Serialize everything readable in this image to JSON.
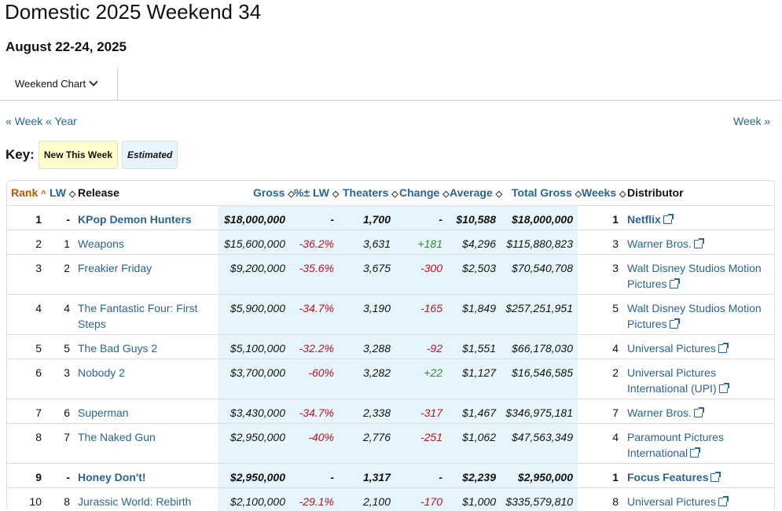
{
  "page": {
    "title": "Domestic 2025 Weekend 34",
    "subtitle": "August 22-24, 2025",
    "tab_label": "Weekend Chart",
    "nav_prev_week": "« Week",
    "nav_prev_year": "« Year",
    "nav_next_week": "Week »",
    "key_label": "Key:",
    "key_new": "New This Week",
    "key_estimated": "Estimated"
  },
  "columns": {
    "rank": "Rank",
    "lw": "LW",
    "release": "Release",
    "gross": "Gross",
    "pct_lw": "%± LW",
    "theaters": "Theaters",
    "change": "Change",
    "average": "Average",
    "total_gross": "Total Gross",
    "weeks": "Weeks",
    "distributor": "Distributor"
  },
  "rows": [
    {
      "rank": "1",
      "lw": "-",
      "release": "KPop Demon Hunters",
      "gross": "$18,000,000",
      "pct": "-",
      "theaters": "1,700",
      "change": "-",
      "average": "$10,588",
      "total": "$18,000,000",
      "weeks": "1",
      "distributor": "Netflix",
      "new": true
    },
    {
      "rank": "2",
      "lw": "1",
      "release": "Weapons",
      "gross": "$15,600,000",
      "pct": "-36.2%",
      "theaters": "3,631",
      "change": "+181",
      "average": "$4,296",
      "total": "$115,880,823",
      "weeks": "3",
      "distributor": "Warner Bros.",
      "new": false
    },
    {
      "rank": "3",
      "lw": "2",
      "release": "Freakier Friday",
      "gross": "$9,200,000",
      "pct": "-35.6%",
      "theaters": "3,675",
      "change": "-300",
      "average": "$2,503",
      "total": "$70,540,708",
      "weeks": "3",
      "distributor": "Walt Disney Studios Motion Pictures",
      "new": false
    },
    {
      "rank": "4",
      "lw": "4",
      "release": "The Fantastic Four: First Steps",
      "gross": "$5,900,000",
      "pct": "-34.7%",
      "theaters": "3,190",
      "change": "-165",
      "average": "$1,849",
      "total": "$257,251,951",
      "weeks": "5",
      "distributor": "Walt Disney Studios Motion Pictures",
      "new": false
    },
    {
      "rank": "5",
      "lw": "5",
      "release": "The Bad Guys 2",
      "gross": "$5,100,000",
      "pct": "-32.2%",
      "theaters": "3,288",
      "change": "-92",
      "average": "$1,551",
      "total": "$66,178,030",
      "weeks": "4",
      "distributor": "Universal Pictures",
      "new": false
    },
    {
      "rank": "6",
      "lw": "3",
      "release": "Nobody 2",
      "gross": "$3,700,000",
      "pct": "-60%",
      "theaters": "3,282",
      "change": "+22",
      "average": "$1,127",
      "total": "$16,546,585",
      "weeks": "2",
      "distributor": "Universal Pictures International (UPI)",
      "new": false
    },
    {
      "rank": "7",
      "lw": "6",
      "release": "Superman",
      "gross": "$3,430,000",
      "pct": "-34.7%",
      "theaters": "2,338",
      "change": "-317",
      "average": "$1,467",
      "total": "$346,975,181",
      "weeks": "7",
      "distributor": "Warner Bros.",
      "new": false
    },
    {
      "rank": "8",
      "lw": "7",
      "release": "The Naked Gun",
      "gross": "$2,950,000",
      "pct": "-40%",
      "theaters": "2,776",
      "change": "-251",
      "average": "$1,062",
      "total": "$47,563,349",
      "weeks": "4",
      "distributor": "Paramount Pictures International",
      "new": false
    },
    {
      "rank": "9",
      "lw": "-",
      "release": "Honey Don't!",
      "gross": "$2,950,000",
      "pct": "-",
      "theaters": "1,317",
      "change": "-",
      "average": "$2,239",
      "total": "$2,950,000",
      "weeks": "1",
      "distributor": "Focus Features",
      "new": true
    },
    {
      "rank": "10",
      "lw": "8",
      "release": "Jurassic World: Rebirth",
      "gross": "$2,100,000",
      "pct": "-29.1%",
      "theaters": "2,100",
      "change": "-170",
      "average": "$1,000",
      "total": "$335,579,810",
      "weeks": "8",
      "distributor": "Universal Pictures",
      "new": false
    }
  ],
  "colors": {
    "link": "#2a6496",
    "negative": "#c0101f",
    "positive": "#2e8b2e",
    "highlight": "#e6f5fb",
    "new_bg": "#ffffcc",
    "sorted_col": "#c45500"
  }
}
